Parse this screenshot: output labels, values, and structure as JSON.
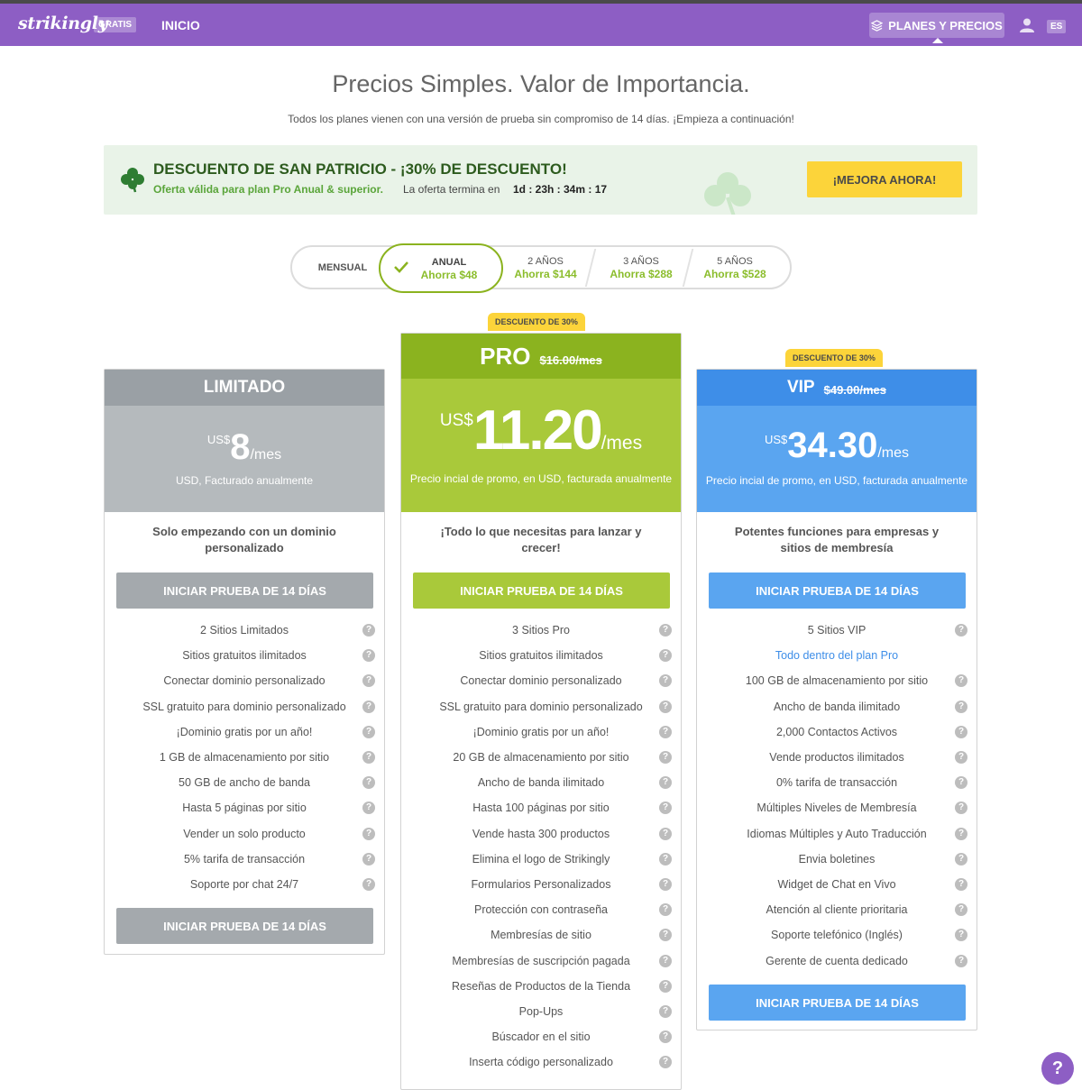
{
  "nav": {
    "logo": "strikingly",
    "badge": "GRATIS",
    "home": "INICIO",
    "plans": "PLANES Y PRECIOS",
    "lang": "ES"
  },
  "header": {
    "title": "Precios Simples. Valor de Importancia.",
    "subtitle": "Todos los planes vienen con una versión de prueba sin compromiso de 14 días. ¡Empieza a continuación!"
  },
  "promo": {
    "headline": "DESCUENTO DE SAN PATRICIO - ¡30% DE DESCUENTO!",
    "offer": "Oferta válida para plan Pro Anual & superior.",
    "ends_label": "La oferta termina en",
    "timer": "1d : 23h : 34m : 17",
    "cta": "¡MEJORA AHORA!"
  },
  "periods": {
    "monthly": "MENSUAL",
    "options": [
      {
        "name": "ANUAL",
        "save": "Ahorra $48"
      },
      {
        "name": "2 AÑOS",
        "save": "Ahorra $144"
      },
      {
        "name": "3 AÑOS",
        "save": "Ahorra $288"
      },
      {
        "name": "5 AÑOS",
        "save": "Ahorra $528"
      }
    ]
  },
  "plans": {
    "limited": {
      "name": "LIMITADO",
      "currency": "US$",
      "price": "8",
      "unit": "/mes",
      "note": "USD, Facturado anualmente",
      "tagline": "Solo empezando con un dominio personalizado",
      "cta": "INICIAR PRUEBA DE 14 DÍAS",
      "cta_bottom": "INICIAR PRUEBA DE 14 DÍAS",
      "features": [
        "2 Sitios Limitados",
        "Sitios gratuitos ilimitados",
        "Conectar dominio personalizado",
        "SSL gratuito para dominio personalizado",
        "¡Dominio gratis por un año!",
        "1 GB de almacenamiento por sitio",
        "50 GB de ancho de banda",
        "Hasta 5 páginas por sitio",
        "Vender un solo producto",
        "5% tarifa de transacción",
        "Soporte por chat 24/7"
      ]
    },
    "pro": {
      "badge": "DESCUENTO DE 30%",
      "name": "PRO",
      "old_price": "$16.00/mes",
      "currency": "US$",
      "price": "11.20",
      "unit": "/mes",
      "note": "Precio incial de promo, en USD, facturada anualmente",
      "tagline": "¡Todo lo que necesitas para lanzar y crecer!",
      "cta": "INICIAR PRUEBA DE 14 DÍAS",
      "features": [
        "3 Sitios Pro",
        "Sitios gratuitos ilimitados",
        "Conectar dominio personalizado",
        "SSL gratuito para dominio personalizado",
        "¡Dominio gratis por un año!",
        "20 GB de almacenamiento por sitio",
        "Ancho de banda ilimitado",
        "Hasta 100 páginas por sitio",
        "Vende hasta 300 productos",
        "Elimina el logo de Strikingly",
        "Formularios Personalizados",
        "Protección con contraseña",
        "Membresías de sitio",
        "Membresías de suscripción pagada",
        "Reseñas de Productos de la Tienda",
        "Pop-Ups",
        "Búscador en el sitio",
        "Inserta código personalizado"
      ]
    },
    "vip": {
      "badge": "DESCUENTO DE 30%",
      "name": "VIP",
      "old_price": "$49.00/mes",
      "currency": "US$",
      "price": "34.30",
      "unit": "/mes",
      "note": "Precio incial de promo, en USD, facturada anualmente",
      "tagline": "Potentes funciones para empresas y sitios de membresía",
      "cta": "INICIAR PRUEBA DE 14 DÍAS",
      "cta_bottom": "INICIAR PRUEBA DE 14 DÍAS",
      "features": [
        "5 Sitios VIP",
        "Todo dentro del plan Pro",
        "100 GB de almacenamiento por sitio",
        "Ancho de banda ilimitado",
        "2,000 Contactos Activos",
        "Vende productos ilimitados",
        "0% tarifa de transacción",
        "Múltiples Niveles de Membresía",
        "Idiomas Múltiples y Auto Traducción",
        "Envia boletines",
        "Widget de Chat en Vivo",
        "Atención al cliente prioritaria",
        "Soporte telefónico (Inglés)",
        "Gerente de cuenta dedicado"
      ]
    }
  },
  "colors": {
    "nav": "#8d5ec4",
    "limited_head": "#9aa0a5",
    "limited_body": "#b5babd",
    "pro_head": "#8bb31f",
    "pro_body": "#a9c93a",
    "vip_head": "#3e8ee8",
    "vip_body": "#5aa5f0",
    "badge": "#fcd43a"
  },
  "help": "?"
}
